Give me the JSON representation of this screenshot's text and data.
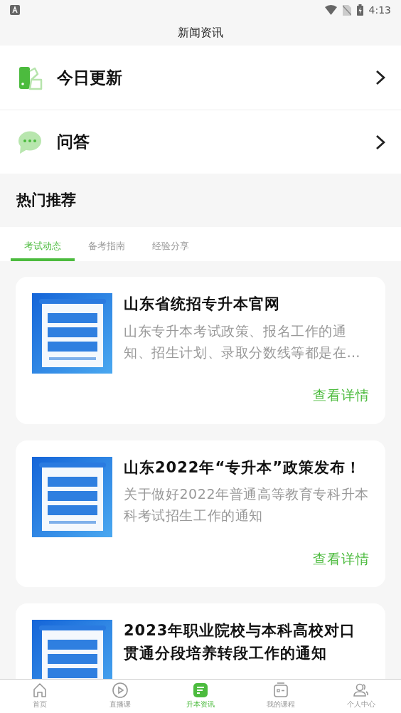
{
  "status_bar": {
    "time": "4:13"
  },
  "title": "新闻资讯",
  "menu": [
    {
      "label": "今日更新",
      "kind": "update"
    },
    {
      "label": "问答",
      "kind": "chat"
    }
  ],
  "section": {
    "title": "热门推荐"
  },
  "tabs": [
    {
      "label": "考试动态",
      "selected": true
    },
    {
      "label": "备考指南",
      "selected": false
    },
    {
      "label": "经验分享",
      "selected": false
    }
  ],
  "articles": [
    {
      "title": "山东省统招专升本官网",
      "summary": "山东专升本考试政策、报名工作的通知、招生计划、录取分数线等都是在…",
      "link": "查看详情"
    },
    {
      "title": "山东2022年“专升本”政策发布！",
      "summary": "关于做好2022年普通高等教育专科升本科考试招生工作的通知",
      "link": "查看详情"
    },
    {
      "title": "2023年职业院校与本科高校对口贯通分段培养转段工作的通知"
    }
  ],
  "bottom_nav": [
    {
      "label": "首页",
      "kind": "home",
      "selected": false
    },
    {
      "label": "直播课",
      "kind": "play",
      "selected": false
    },
    {
      "label": "升本资讯",
      "kind": "news",
      "selected": true
    },
    {
      "label": "我的课程",
      "kind": "course",
      "selected": false
    },
    {
      "label": "个人中心",
      "kind": "user",
      "selected": false
    }
  ]
}
